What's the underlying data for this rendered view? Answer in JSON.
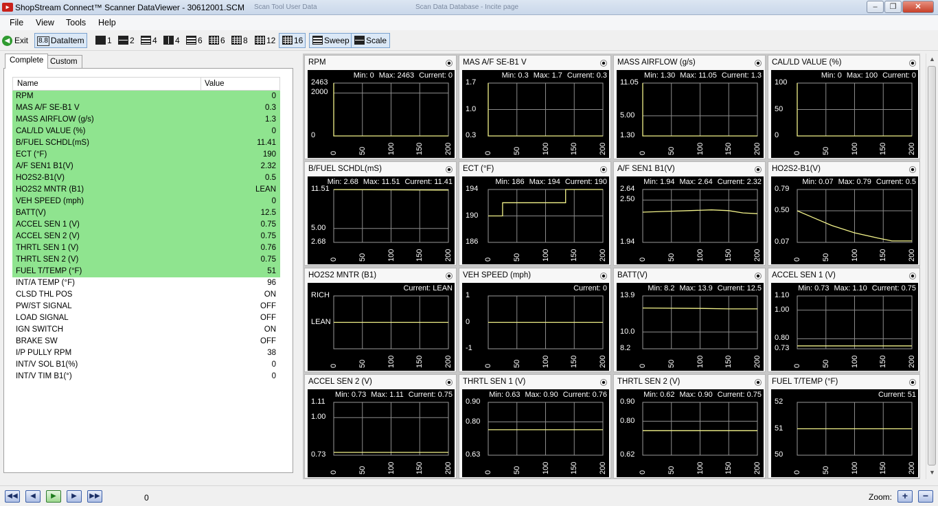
{
  "window": {
    "title": "ShopStream Connect™ Scanner DataViewer - 30612001.SCM",
    "app_icon": "snap-on-logo-icon",
    "ghost_tabs": [
      "Scan Tool User Data",
      "Scan Data Database - Incite page"
    ]
  },
  "menu": [
    "File",
    "View",
    "Tools",
    "Help"
  ],
  "toolbar": {
    "exit_label": "Exit",
    "dataitem_label": "DataItem",
    "layouts": [
      "1",
      "2",
      "4",
      "4",
      "6",
      "6",
      "8",
      "12",
      "16"
    ],
    "active_layout": "16",
    "sweep_label": "Sweep",
    "scale_label": "Scale"
  },
  "tabs": [
    "Complete",
    "Custom"
  ],
  "table": {
    "headers": {
      "name": "Name",
      "value": "Value"
    },
    "rows": [
      {
        "name": "RPM",
        "value": "0",
        "highlighted": true
      },
      {
        "name": "MAS A/F SE-B1 V",
        "value": "0.3",
        "highlighted": true
      },
      {
        "name": "MASS AIRFLOW (g/s)",
        "value": "1.3",
        "highlighted": true
      },
      {
        "name": "CAL/LD VALUE (%)",
        "value": "0",
        "highlighted": true
      },
      {
        "name": "B/FUEL SCHDL(mS)",
        "value": "11.41",
        "highlighted": true
      },
      {
        "name": "ECT (°F)",
        "value": "190",
        "highlighted": true
      },
      {
        "name": "A/F SEN1 B1(V)",
        "value": "2.32",
        "highlighted": true
      },
      {
        "name": "HO2S2-B1(V)",
        "value": "0.5",
        "highlighted": true
      },
      {
        "name": "HO2S2 MNTR (B1)",
        "value": "LEAN",
        "highlighted": true
      },
      {
        "name": "VEH SPEED (mph)",
        "value": "0",
        "highlighted": true
      },
      {
        "name": "BATT(V)",
        "value": "12.5",
        "highlighted": true
      },
      {
        "name": "ACCEL SEN 1 (V)",
        "value": "0.75",
        "highlighted": true
      },
      {
        "name": "ACCEL SEN 2 (V)",
        "value": "0.75",
        "highlighted": true
      },
      {
        "name": "THRTL SEN 1 (V)",
        "value": "0.76",
        "highlighted": true
      },
      {
        "name": "THRTL SEN 2 (V)",
        "value": "0.75",
        "highlighted": true
      },
      {
        "name": "FUEL T/TEMP (°F)",
        "value": "51",
        "highlighted": true
      },
      {
        "name": "INT/A TEMP (°F)",
        "value": "96",
        "highlighted": false
      },
      {
        "name": "CLSD THL POS",
        "value": "ON",
        "highlighted": false
      },
      {
        "name": "PW/ST SIGNAL",
        "value": "OFF",
        "highlighted": false
      },
      {
        "name": "LOAD SIGNAL",
        "value": "OFF",
        "highlighted": false
      },
      {
        "name": "IGN SWITCH",
        "value": "ON",
        "highlighted": false
      },
      {
        "name": "BRAKE SW",
        "value": "OFF",
        "highlighted": false
      },
      {
        "name": "I/P PULLY RPM",
        "value": "38",
        "highlighted": false
      },
      {
        "name": "INT/V SOL B1(%)",
        "value": "0",
        "highlighted": false
      },
      {
        "name": "INT/V TIM B1(°)",
        "value": "0",
        "highlighted": false
      }
    ]
  },
  "graphs": [
    {
      "title": "RPM",
      "min": "Min: 0",
      "max": "Max: 2463",
      "current": "Current: 0",
      "yrange": [
        0,
        2463
      ],
      "yticks": [
        [
          "2463",
          2463
        ],
        [
          "2000",
          2000
        ],
        [
          "0",
          0
        ]
      ],
      "trace": [
        [
          0,
          2463
        ],
        [
          0,
          0
        ],
        [
          200,
          0
        ]
      ]
    },
    {
      "title": "MAS A/F SE-B1 V",
      "min": "Min: 0.3",
      "max": "Max: 1.7",
      "current": "Current: 0.3",
      "yrange": [
        0.3,
        1.7
      ],
      "yticks": [
        [
          "1.7",
          1.7
        ],
        [
          "1.0",
          1.0
        ],
        [
          "0.3",
          0.3
        ]
      ],
      "trace": [
        [
          0,
          1.7
        ],
        [
          0,
          0.3
        ],
        [
          200,
          0.3
        ]
      ]
    },
    {
      "title": "MASS AIRFLOW (g/s)",
      "min": "Min: 1.30",
      "max": "Max: 11.05",
      "current": "Current: 1.3",
      "yrange": [
        1.3,
        11.05
      ],
      "yticks": [
        [
          "11.05",
          11.05
        ],
        [
          "5.00",
          5.0
        ],
        [
          "1.30",
          1.3
        ]
      ],
      "trace": [
        [
          0,
          11.05
        ],
        [
          0,
          1.3
        ],
        [
          200,
          1.3
        ]
      ]
    },
    {
      "title": "CAL/LD VALUE (%)",
      "min": "Min: 0",
      "max": "Max: 100",
      "current": "Current: 0",
      "yrange": [
        0,
        100
      ],
      "yticks": [
        [
          "100",
          100
        ],
        [
          "50",
          50
        ],
        [
          "0",
          0
        ]
      ],
      "trace": [
        [
          0,
          100
        ],
        [
          0,
          0
        ],
        [
          200,
          0
        ]
      ]
    },
    {
      "title": "B/FUEL SCHDL(mS)",
      "min": "Min: 2.68",
      "max": "Max: 11.51",
      "current": "Current: 11.41",
      "yrange": [
        2.68,
        11.51
      ],
      "yticks": [
        [
          "11.51",
          11.51
        ],
        [
          "5.00",
          5.0
        ],
        [
          "2.68",
          2.68
        ]
      ],
      "trace": [
        [
          0,
          11.5
        ],
        [
          100,
          11.45
        ],
        [
          200,
          11.41
        ]
      ]
    },
    {
      "title": "ECT (°F)",
      "min": "Min: 186",
      "max": "Max: 194",
      "current": "Current: 190",
      "yrange": [
        186,
        194
      ],
      "yticks": [
        [
          "194",
          194
        ],
        [
          "190",
          190
        ],
        [
          "186",
          186
        ]
      ],
      "trace": [
        [
          0,
          190
        ],
        [
          25,
          190
        ],
        [
          25,
          192
        ],
        [
          135,
          192
        ],
        [
          135,
          194
        ],
        [
          200,
          194
        ]
      ]
    },
    {
      "title": "A/F SEN1 B1(V)",
      "min": "Min: 1.94",
      "max": "Max: 2.64",
      "current": "Current: 2.32",
      "yrange": [
        1.94,
        2.64
      ],
      "yticks": [
        [
          "2.64",
          2.64
        ],
        [
          "2.50",
          2.5
        ],
        [
          "1.94",
          1.94
        ]
      ],
      "trace": [
        [
          0,
          2.34
        ],
        [
          40,
          2.35
        ],
        [
          80,
          2.36
        ],
        [
          120,
          2.37
        ],
        [
          150,
          2.36
        ],
        [
          175,
          2.33
        ],
        [
          200,
          2.32
        ]
      ]
    },
    {
      "title": "HO2S2-B1(V)",
      "min": "Min: 0.07",
      "max": "Max: 0.79",
      "current": "Current: 0.5",
      "yrange": [
        0.07,
        0.79
      ],
      "yticks": [
        [
          "0.79",
          0.79
        ],
        [
          "0.50",
          0.5
        ],
        [
          "0.07",
          0.07
        ]
      ],
      "trace": [
        [
          0,
          0.5
        ],
        [
          30,
          0.4
        ],
        [
          60,
          0.3
        ],
        [
          100,
          0.2
        ],
        [
          140,
          0.13
        ],
        [
          165,
          0.09
        ],
        [
          200,
          0.09
        ]
      ]
    },
    {
      "title": "HO2S2 MNTR (B1)",
      "min": "",
      "max": "",
      "current": "Current: LEAN",
      "yrange": [
        0,
        1
      ],
      "yticks": [
        [
          "RICH",
          1
        ],
        [
          "LEAN",
          0.5
        ]
      ],
      "trace": [
        [
          0,
          0.5
        ],
        [
          200,
          0.5
        ]
      ]
    },
    {
      "title": "VEH SPEED (mph)",
      "min": "",
      "max": "",
      "current": "Current: 0",
      "yrange": [
        -1,
        1
      ],
      "yticks": [
        [
          "1",
          1
        ],
        [
          "0",
          0
        ],
        [
          "-1",
          -1
        ]
      ],
      "trace": [
        [
          0,
          0
        ],
        [
          200,
          0
        ]
      ]
    },
    {
      "title": "BATT(V)",
      "min": "Min: 8.2",
      "max": "Max: 13.9",
      "current": "Current: 12.5",
      "yrange": [
        8.2,
        13.9
      ],
      "yticks": [
        [
          "13.9",
          13.9
        ],
        [
          "10.0",
          10.0
        ],
        [
          "8.2",
          8.2
        ]
      ],
      "trace": [
        [
          0,
          12.6
        ],
        [
          100,
          12.55
        ],
        [
          150,
          12.5
        ],
        [
          200,
          12.5
        ]
      ]
    },
    {
      "title": "ACCEL SEN 1 (V)",
      "min": "Min: 0.73",
      "max": "Max: 1.10",
      "current": "Current: 0.75",
      "yrange": [
        0.73,
        1.1
      ],
      "yticks": [
        [
          "1.10",
          1.1
        ],
        [
          "1.00",
          1.0
        ],
        [
          "0.80",
          0.8
        ],
        [
          "0.73",
          0.73
        ]
      ],
      "trace": [
        [
          0,
          0.75
        ],
        [
          200,
          0.75
        ]
      ]
    },
    {
      "title": "ACCEL SEN 2 (V)",
      "min": "Min: 0.73",
      "max": "Max: 1.11",
      "current": "Current: 0.75",
      "yrange": [
        0.73,
        1.11
      ],
      "yticks": [
        [
          "1.11",
          1.11
        ],
        [
          "1.00",
          1.0
        ],
        [
          "0.73",
          0.73
        ]
      ],
      "trace": [
        [
          0,
          0.75
        ],
        [
          200,
          0.75
        ]
      ]
    },
    {
      "title": "THRTL SEN 1 (V)",
      "min": "Min: 0.63",
      "max": "Max: 0.90",
      "current": "Current: 0.76",
      "yrange": [
        0.63,
        0.9
      ],
      "yticks": [
        [
          "0.90",
          0.9
        ],
        [
          "0.80",
          0.8
        ],
        [
          "0.63",
          0.63
        ]
      ],
      "trace": [
        [
          0,
          0.76
        ],
        [
          200,
          0.76
        ]
      ]
    },
    {
      "title": "THRTL SEN 2 (V)",
      "min": "Min: 0.62",
      "max": "Max: 0.90",
      "current": "Current: 0.75",
      "yrange": [
        0.62,
        0.9
      ],
      "yticks": [
        [
          "0.90",
          0.9
        ],
        [
          "0.80",
          0.8
        ],
        [
          "0.62",
          0.62
        ]
      ],
      "trace": [
        [
          0,
          0.75
        ],
        [
          200,
          0.75
        ]
      ]
    },
    {
      "title": "FUEL T/TEMP (°F)",
      "min": "",
      "max": "",
      "current": "Current: 51",
      "yrange": [
        50,
        52
      ],
      "yticks": [
        [
          "52",
          52
        ],
        [
          "51",
          51
        ],
        [
          "50",
          50
        ]
      ],
      "trace": [
        [
          0,
          51
        ],
        [
          200,
          51
        ]
      ]
    }
  ],
  "x_ticks": [
    "0",
    "50",
    "100",
    "150",
    "200"
  ],
  "x_range": [
    0,
    200
  ],
  "bottom": {
    "frame_count": "0",
    "zoom_label": "Zoom:",
    "nav_icons": [
      "first-frame-icon",
      "prev-frame-icon",
      "play-icon",
      "next-frame-icon",
      "last-frame-icon"
    ]
  }
}
